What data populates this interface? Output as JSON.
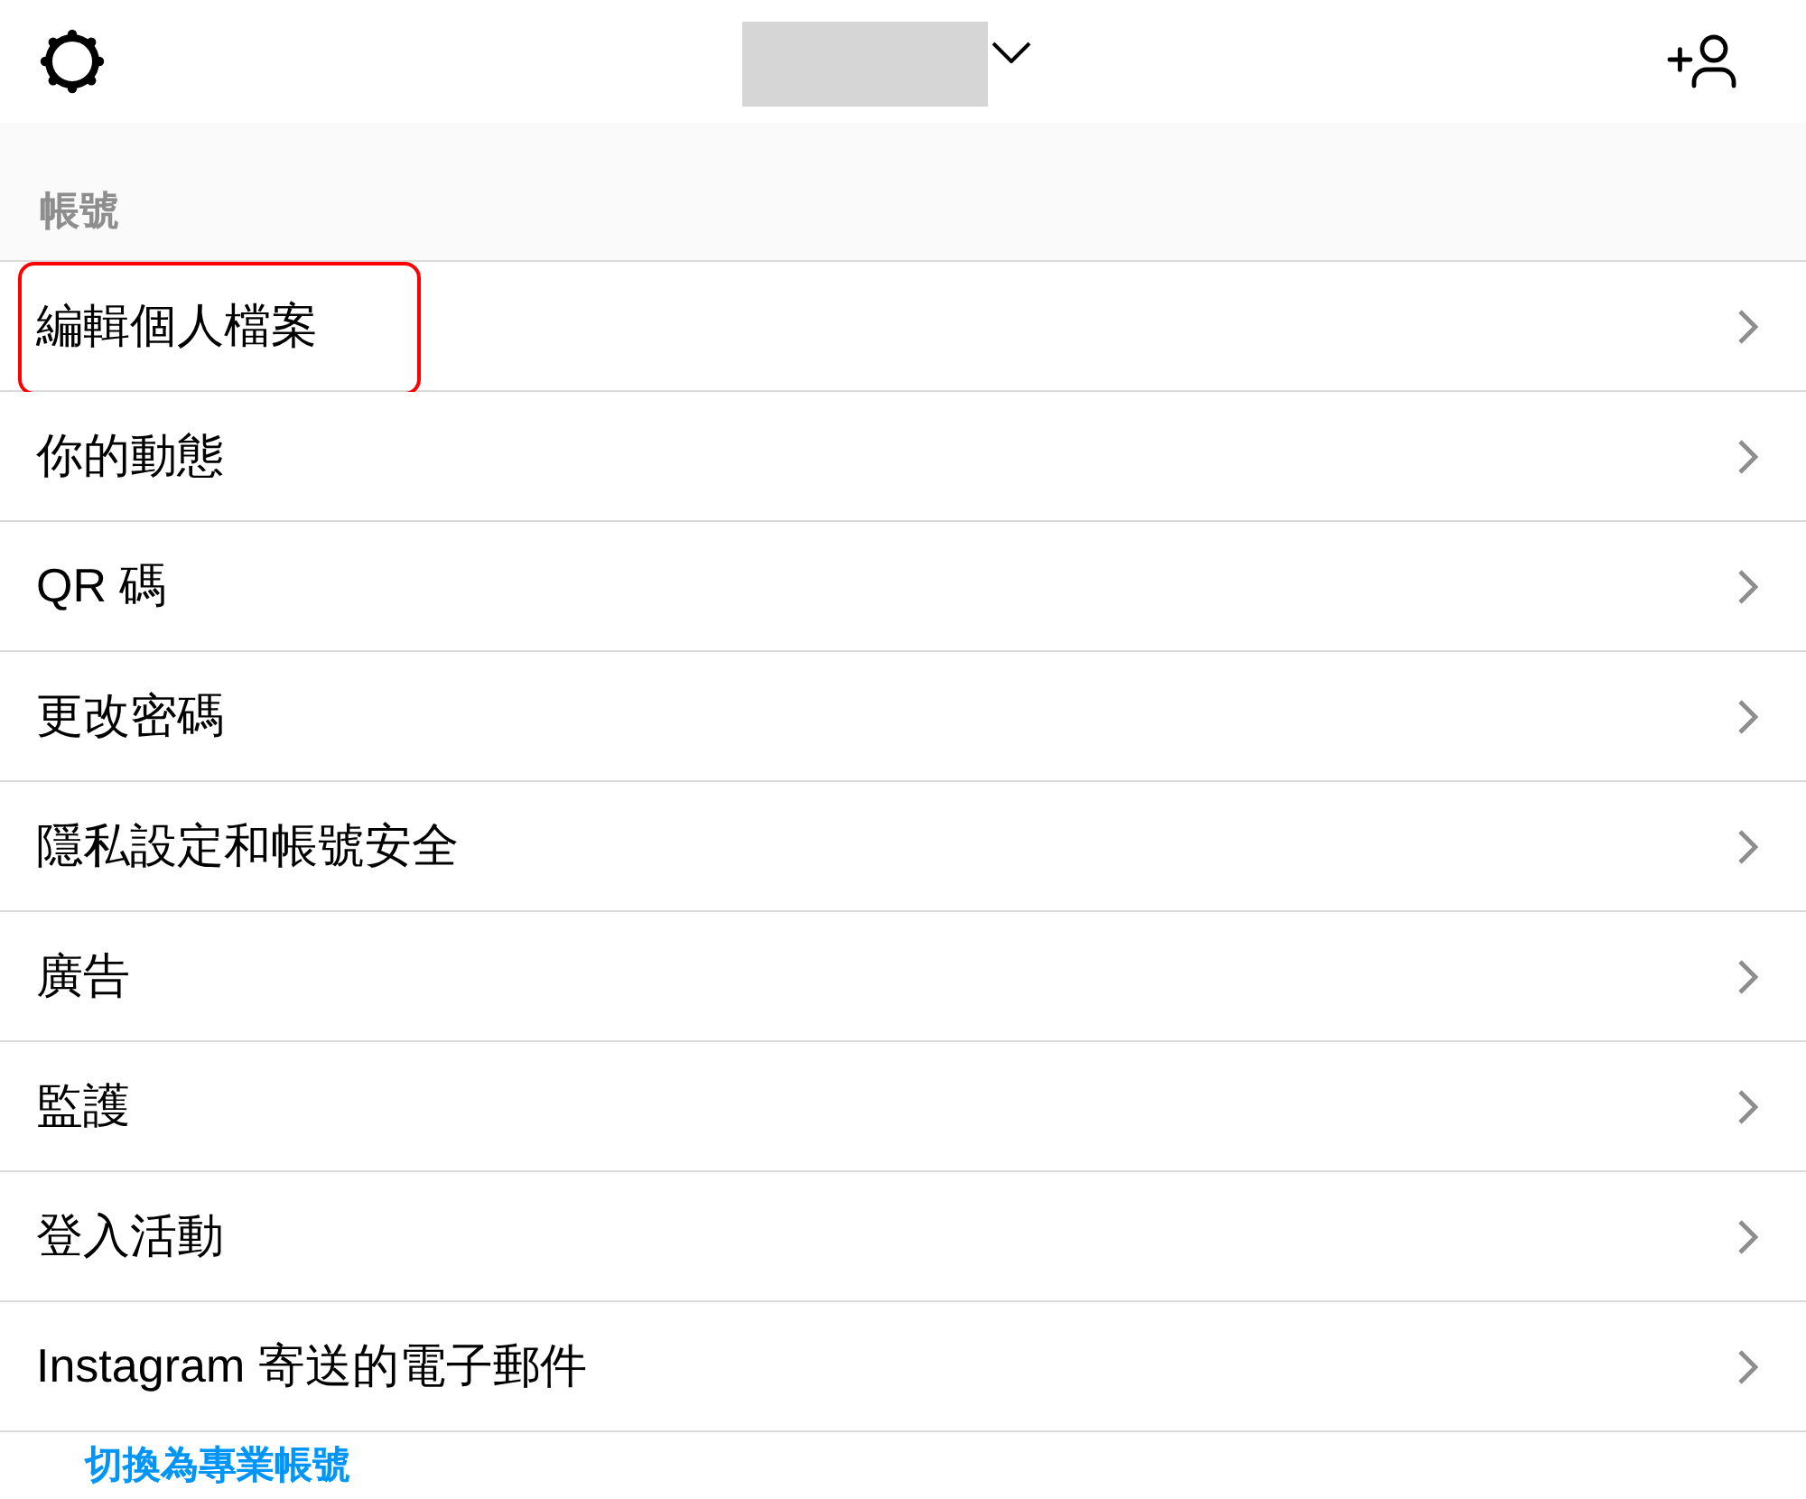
{
  "section": {
    "title": "帳號"
  },
  "items": [
    {
      "label": "編輯個人檔案",
      "highlighted": true
    },
    {
      "label": "你的動態",
      "highlighted": false
    },
    {
      "label": "QR 碼",
      "highlighted": false
    },
    {
      "label": "更改密碼",
      "highlighted": false
    },
    {
      "label": "隱私設定和帳號安全",
      "highlighted": false
    },
    {
      "label": "廣告",
      "highlighted": false
    },
    {
      "label": "監護",
      "highlighted": false
    },
    {
      "label": "登入活動",
      "highlighted": false
    },
    {
      "label": "Instagram 寄送的電子郵件",
      "highlighted": false
    }
  ],
  "footer_link": {
    "label": "切換為專業帳號"
  }
}
